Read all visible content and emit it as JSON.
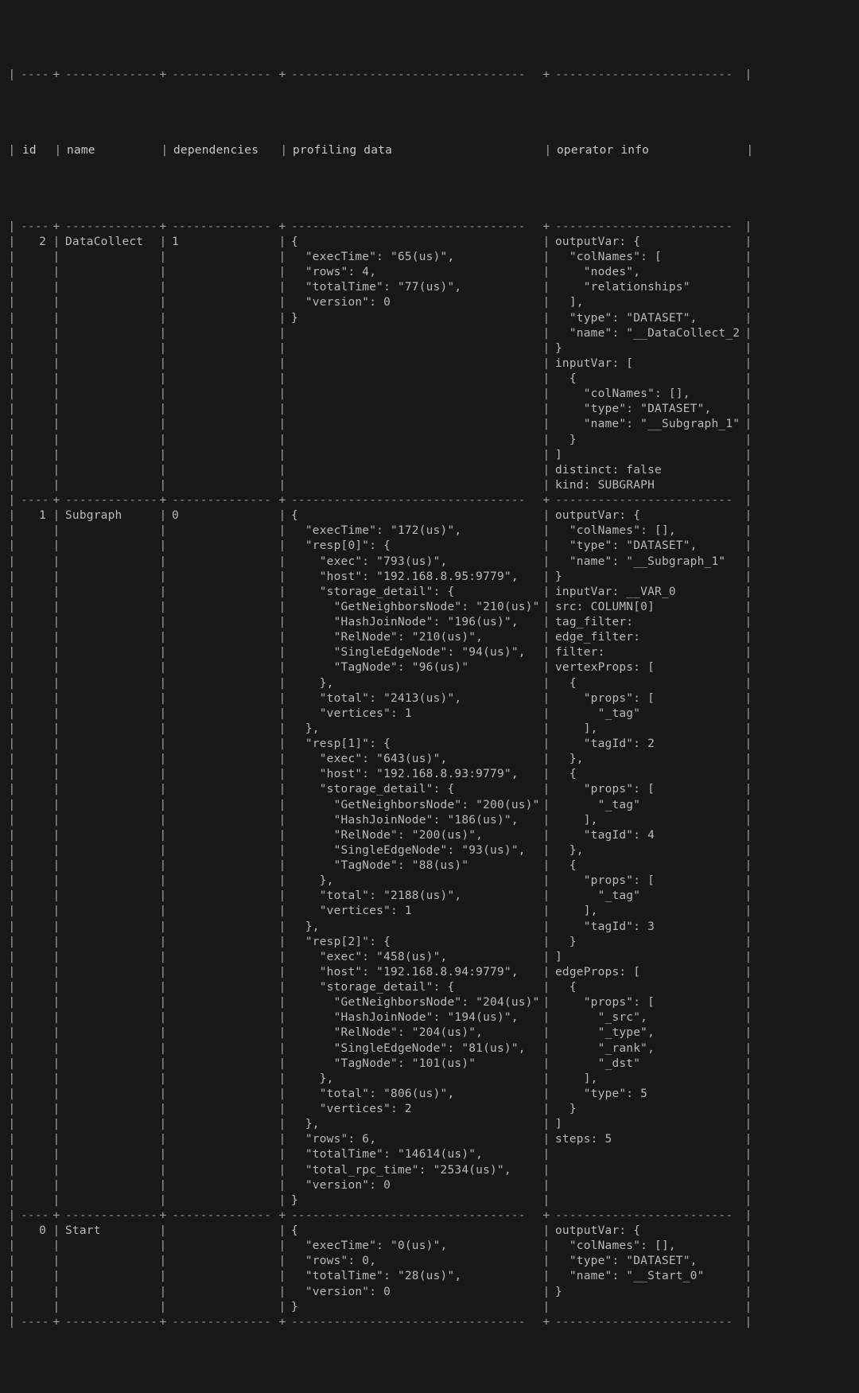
{
  "headers": {
    "id": "id",
    "name": "name",
    "dependencies": "dependencies",
    "profiling_data": "profiling data",
    "operator_info": "operator info"
  },
  "border": {
    "pipe": "|",
    "plus": "+",
    "dash_id": "----",
    "dash_name": "-------------",
    "dash_dep": "--------------",
    "dash_prof": "---------------------------------",
    "dash_op": "-------------------------"
  },
  "rows": [
    {
      "id": "2",
      "name": "DataCollect",
      "dependencies": "1",
      "profiling_lines": [
        "{",
        "  \"execTime\": \"65(us)\",",
        "  \"rows\": 4,",
        "  \"totalTime\": \"77(us)\",",
        "  \"version\": 0",
        "}"
      ],
      "operator_lines": [
        "outputVar: {",
        "  \"colNames\": [",
        "    \"nodes\",",
        "    \"relationships\"",
        "  ],",
        "  \"type\": \"DATASET\",",
        "  \"name\": \"__DataCollect_2\"",
        "}",
        "inputVar: [",
        "  {",
        "    \"colNames\": [],",
        "    \"type\": \"DATASET\",",
        "    \"name\": \"__Subgraph_1\"",
        "  }",
        "]",
        "distinct: false",
        "kind: SUBGRAPH"
      ]
    },
    {
      "id": "1",
      "name": "Subgraph",
      "dependencies": "0",
      "profiling_lines": [
        "{",
        "  \"execTime\": \"172(us)\",",
        "  \"resp[0]\": {",
        "    \"exec\": \"793(us)\",",
        "    \"host\": \"192.168.8.95:9779\",",
        "    \"storage_detail\": {",
        "      \"GetNeighborsNode\": \"210(us)\",",
        "      \"HashJoinNode\": \"196(us)\",",
        "      \"RelNode\": \"210(us)\",",
        "      \"SingleEdgeNode\": \"94(us)\",",
        "      \"TagNode\": \"96(us)\"",
        "    },",
        "    \"total\": \"2413(us)\",",
        "    \"vertices\": 1",
        "  },",
        "  \"resp[1]\": {",
        "    \"exec\": \"643(us)\",",
        "    \"host\": \"192.168.8.93:9779\",",
        "    \"storage_detail\": {",
        "      \"GetNeighborsNode\": \"200(us)\",",
        "      \"HashJoinNode\": \"186(us)\",",
        "      \"RelNode\": \"200(us)\",",
        "      \"SingleEdgeNode\": \"93(us)\",",
        "      \"TagNode\": \"88(us)\"",
        "    },",
        "    \"total\": \"2188(us)\",",
        "    \"vertices\": 1",
        "  },",
        "  \"resp[2]\": {",
        "    \"exec\": \"458(us)\",",
        "    \"host\": \"192.168.8.94:9779\",",
        "    \"storage_detail\": {",
        "      \"GetNeighborsNode\": \"204(us)\",",
        "      \"HashJoinNode\": \"194(us)\",",
        "      \"RelNode\": \"204(us)\",",
        "      \"SingleEdgeNode\": \"81(us)\",",
        "      \"TagNode\": \"101(us)\"",
        "    },",
        "    \"total\": \"806(us)\",",
        "    \"vertices\": 2",
        "  },",
        "  \"rows\": 6,",
        "  \"totalTime\": \"14614(us)\",",
        "  \"total_rpc_time\": \"2534(us)\",",
        "  \"version\": 0",
        "}"
      ],
      "operator_lines": [
        "outputVar: {",
        "  \"colNames\": [],",
        "  \"type\": \"DATASET\",",
        "  \"name\": \"__Subgraph_1\"",
        "}",
        "inputVar: __VAR_0",
        "src: COLUMN[0]",
        "tag_filter:",
        "edge_filter:",
        "filter:",
        "vertexProps: [",
        "  {",
        "    \"props\": [",
        "      \"_tag\"",
        "    ],",
        "    \"tagId\": 2",
        "  },",
        "  {",
        "    \"props\": [",
        "      \"_tag\"",
        "    ],",
        "    \"tagId\": 4",
        "  },",
        "  {",
        "    \"props\": [",
        "      \"_tag\"",
        "    ],",
        "    \"tagId\": 3",
        "  }",
        "]",
        "edgeProps: [",
        "  {",
        "    \"props\": [",
        "      \"_src\",",
        "      \"_type\",",
        "      \"_rank\",",
        "      \"_dst\"",
        "    ],",
        "    \"type\": 5",
        "  }",
        "]",
        "steps: 5"
      ]
    },
    {
      "id": "0",
      "name": "Start",
      "dependencies": "",
      "profiling_lines": [
        "{",
        "  \"execTime\": \"0(us)\",",
        "  \"rows\": 0,",
        "  \"totalTime\": \"28(us)\",",
        "  \"version\": 0",
        "}"
      ],
      "operator_lines": [
        "outputVar: {",
        "  \"colNames\": [],",
        "  \"type\": \"DATASET\",",
        "  \"name\": \"__Start_0\"",
        "}"
      ]
    }
  ]
}
